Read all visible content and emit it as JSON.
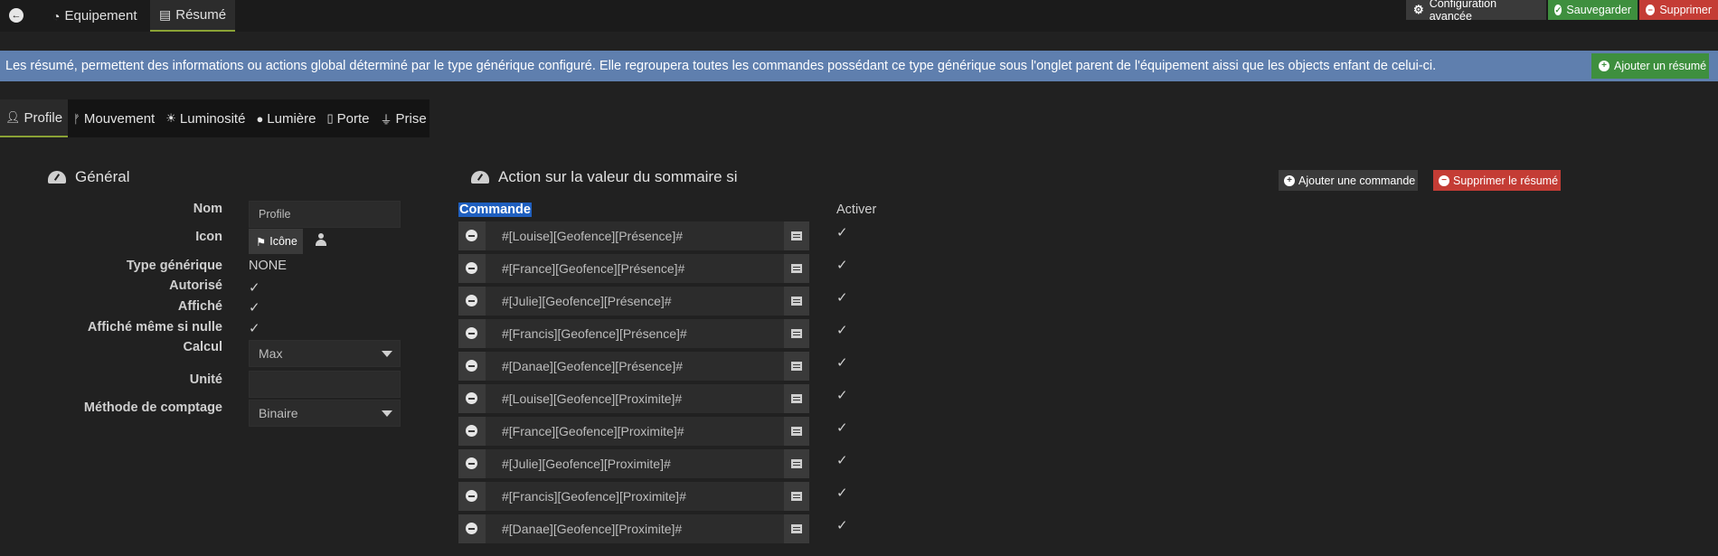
{
  "topbar": {
    "back_label": "←",
    "tabs": [
      {
        "label": "Equipement",
        "icon": "tachometer-icon"
      },
      {
        "label": "Résumé",
        "icon": "list-alt-icon"
      }
    ],
    "buttons": {
      "config": "Configuration avancée",
      "save": "Sauvegarder",
      "delete": "Supprimer"
    }
  },
  "banner": {
    "text": "Les résumé, permettent des informations ou actions global déterminé par le type générique configuré. Elle regroupera toutes les commandes possédant ce type générique sous l'onglet parent de l'équipement aissi que les objects enfant de celui-ci.",
    "add_button": "Ajouter un résumé",
    "color": "#5f7fae"
  },
  "subtabs": [
    {
      "label": "Profile",
      "icon": "user-icon"
    },
    {
      "label": "Mouvement",
      "icon": "running-icon"
    },
    {
      "label": "Luminosité",
      "icon": "sun-icon"
    },
    {
      "label": "Lumière",
      "icon": "lightbulb-icon"
    },
    {
      "label": "Porte",
      "icon": "door-icon"
    },
    {
      "label": "Prise",
      "icon": "plug-icon"
    }
  ],
  "general": {
    "title": "Général",
    "labels": {
      "nom": "Nom",
      "icon": "Icon",
      "type": "Type générique",
      "autorise": "Autorisé",
      "affiche": "Affiché",
      "affiche_nulle": "Affiché même si nulle",
      "calcul": "Calcul",
      "unite": "Unité",
      "methode": "Méthode de comptage"
    },
    "values": {
      "nom": "Profile",
      "icon_button": "Icône",
      "type": "NONE",
      "calcul": "Max",
      "unite": "",
      "methode": "Binaire"
    },
    "check_mark": "✓"
  },
  "action": {
    "title": "Action sur la valeur du sommaire si",
    "add_command": "Ajouter une commande",
    "delete_summary": "Supprimer le résumé",
    "col_commande": "Commande",
    "col_activer": "Activer",
    "commands": [
      "#[Louise][Geofence][Présence]#",
      "#[France][Geofence][Présence]#",
      "#[Julie][Geofence][Présence]#",
      "#[Francis][Geofence][Présence]#",
      "#[Danae][Geofence][Présence]#",
      "#[Louise][Geofence][Proximite]#",
      "#[France][Geofence][Proximite]#",
      "#[Julie][Geofence][Proximite]#",
      "#[Francis][Geofence][Proximite]#",
      "#[Danae][Geofence][Proximite]#"
    ]
  },
  "colors": {
    "save": "#3e8f3e",
    "delete": "#c43c35",
    "active_tab_underline": "#8aa235",
    "highlight": "#1f5fbf"
  }
}
